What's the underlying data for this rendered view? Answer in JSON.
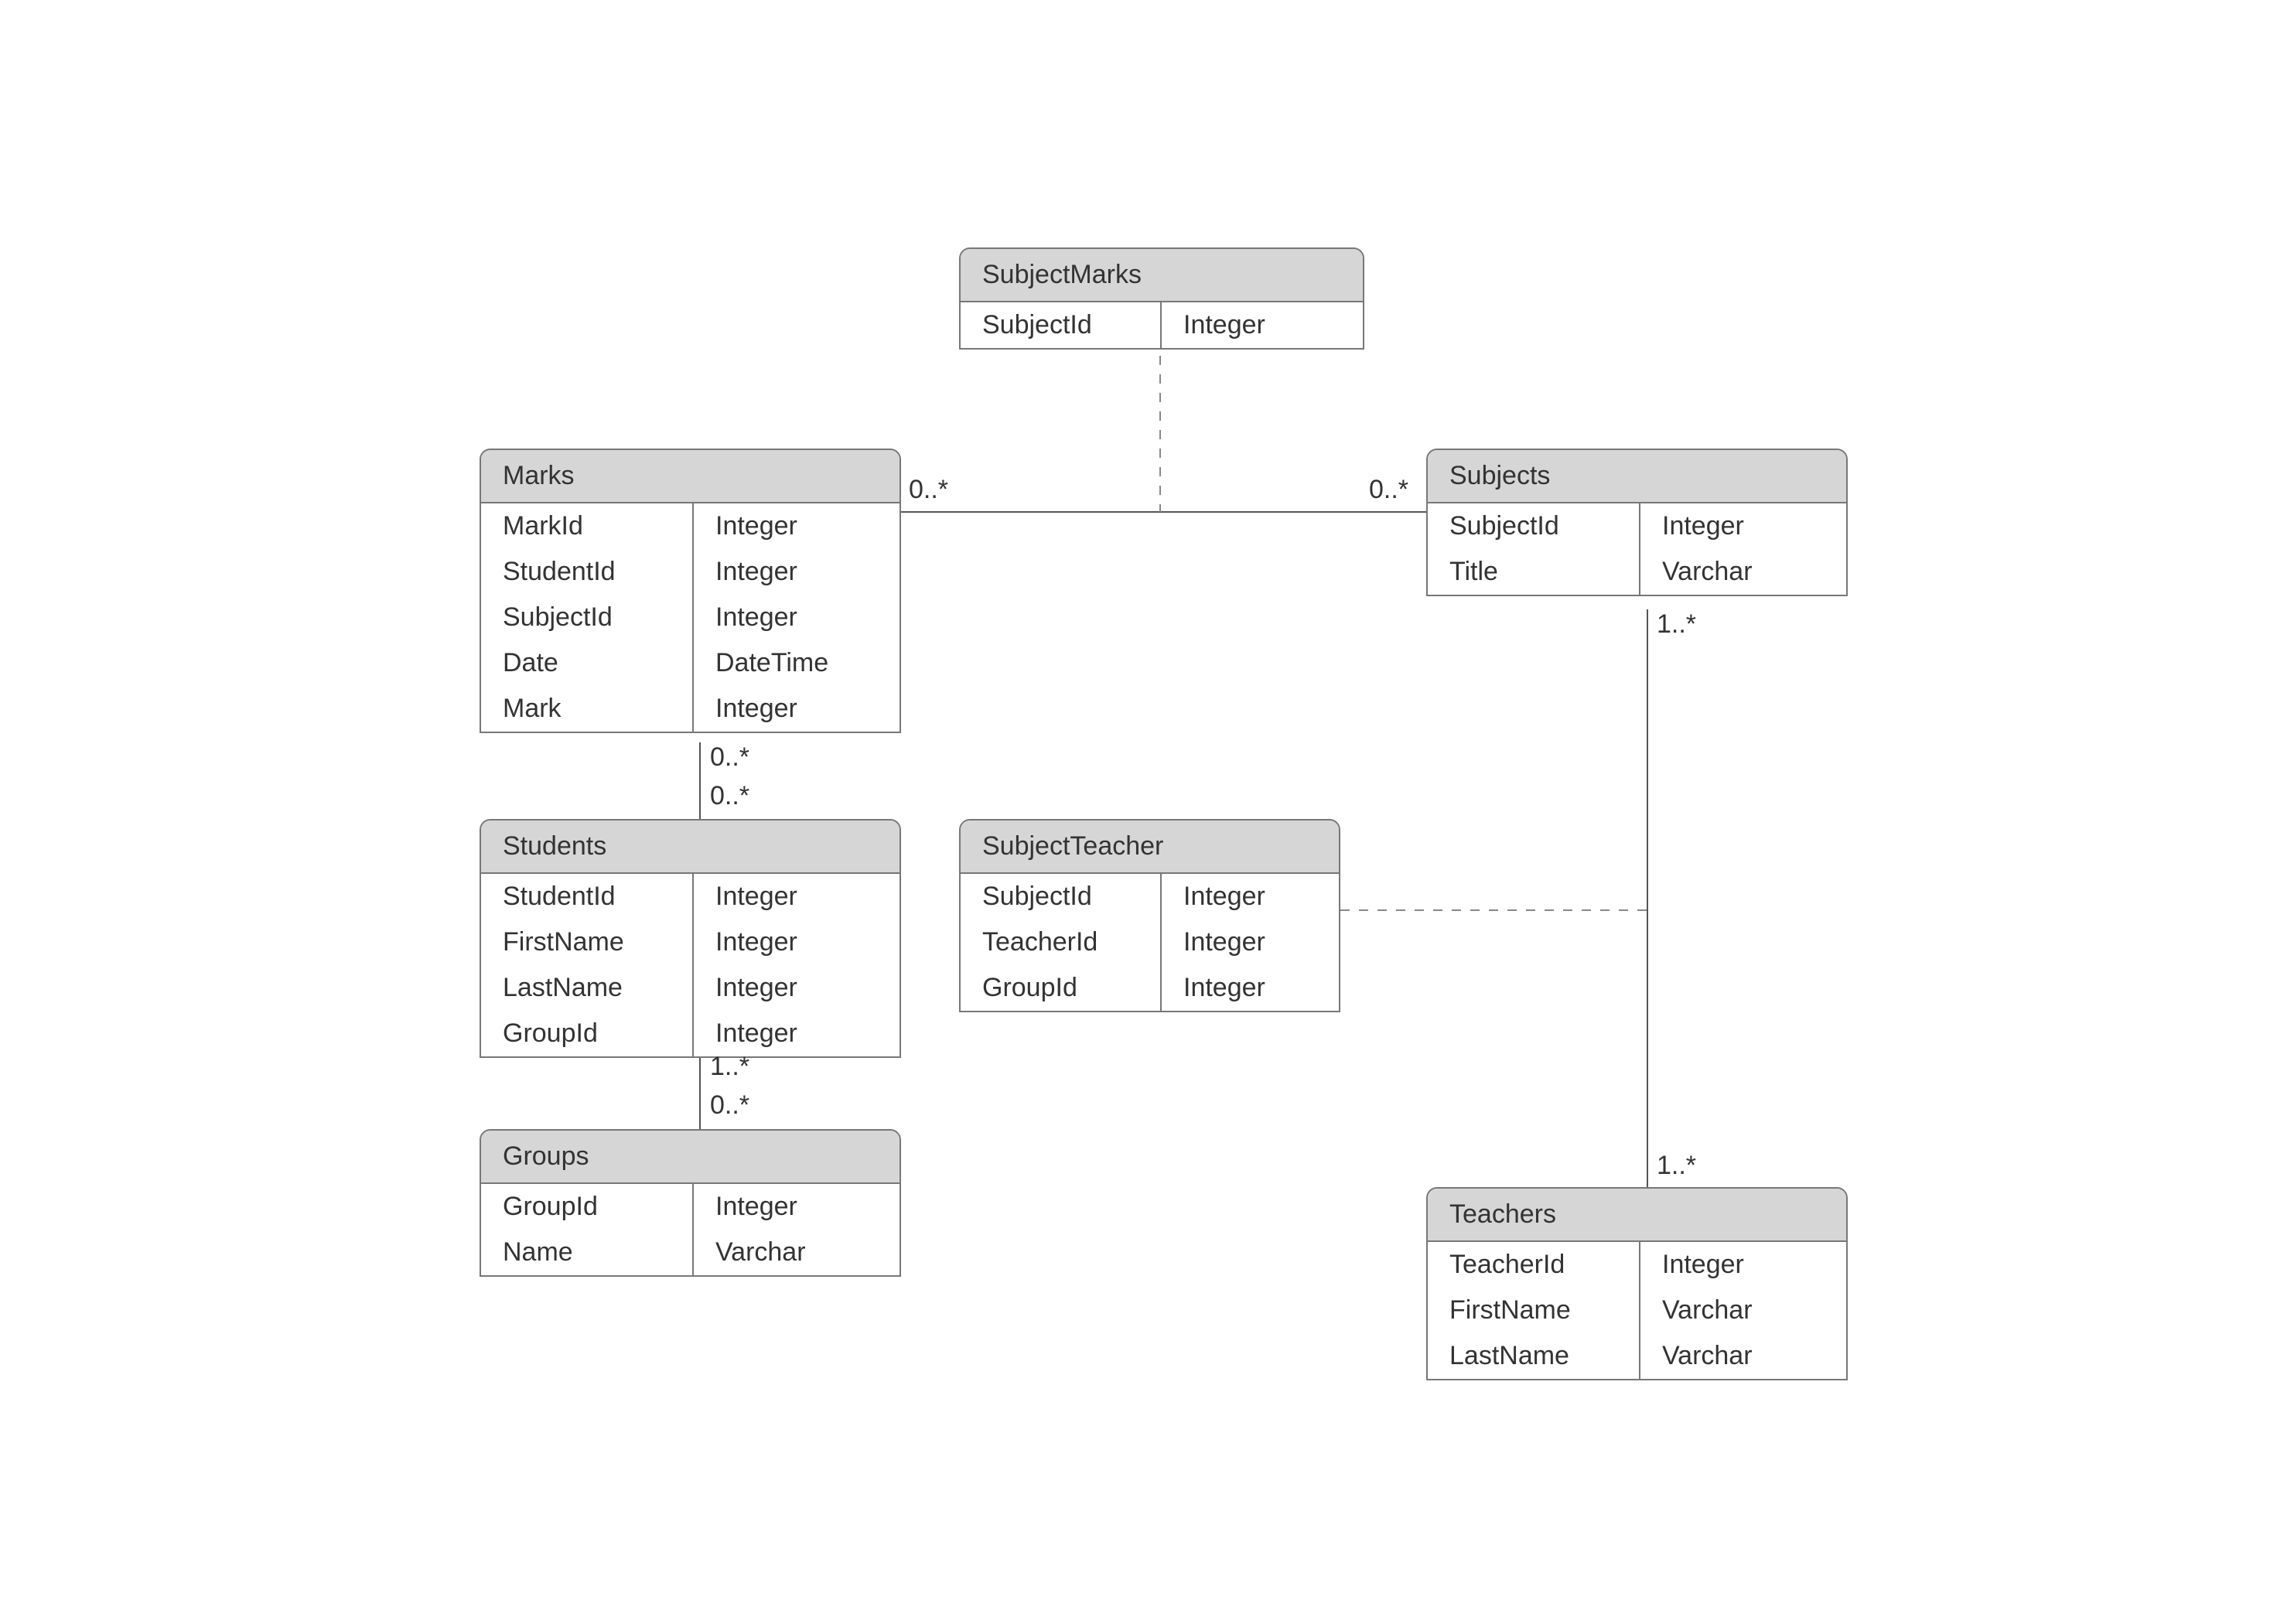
{
  "entities": {
    "subjectMarks": {
      "title": "SubjectMarks",
      "attrs": [
        {
          "name": "SubjectId",
          "type": "Integer"
        }
      ]
    },
    "marks": {
      "title": "Marks",
      "attrs": [
        {
          "name": "MarkId",
          "type": "Integer"
        },
        {
          "name": "StudentId",
          "type": "Integer"
        },
        {
          "name": "SubjectId",
          "type": "Integer"
        },
        {
          "name": "Date",
          "type": "DateTime"
        },
        {
          "name": "Mark",
          "type": "Integer"
        }
      ]
    },
    "subjects": {
      "title": "Subjects",
      "attrs": [
        {
          "name": "SubjectId",
          "type": "Integer"
        },
        {
          "name": "Title",
          "type": "Varchar"
        }
      ]
    },
    "students": {
      "title": "Students",
      "attrs": [
        {
          "name": "StudentId",
          "type": "Integer"
        },
        {
          "name": "FirstName",
          "type": "Integer"
        },
        {
          "name": "LastName",
          "type": "Integer"
        },
        {
          "name": "GroupId",
          "type": "Integer"
        }
      ]
    },
    "subjectTeacher": {
      "title": "SubjectTeacher",
      "attrs": [
        {
          "name": "SubjectId",
          "type": "Integer"
        },
        {
          "name": "TeacherId",
          "type": "Integer"
        },
        {
          "name": "GroupId",
          "type": "Integer"
        }
      ]
    },
    "groups": {
      "title": "Groups",
      "attrs": [
        {
          "name": "GroupId",
          "type": "Integer"
        },
        {
          "name": "Name",
          "type": "Varchar"
        }
      ]
    },
    "teachers": {
      "title": "Teachers",
      "attrs": [
        {
          "name": "TeacherId",
          "type": "Integer"
        },
        {
          "name": "FirstName",
          "type": "Varchar"
        },
        {
          "name": "LastName",
          "type": "Varchar"
        }
      ]
    }
  },
  "multiplicities": {
    "marksToSubjects_left": "0..*",
    "marksToSubjects_right": "0..*",
    "subjectsToTeachers_top": "1..*",
    "subjectsToTeachers_bottom": "1..*",
    "marksToStudents_top": "0..*",
    "marksToStudents_bottom": "0..*",
    "studentsToGroups_top": "1..*",
    "studentsToGroups_bottom": "0..*"
  }
}
